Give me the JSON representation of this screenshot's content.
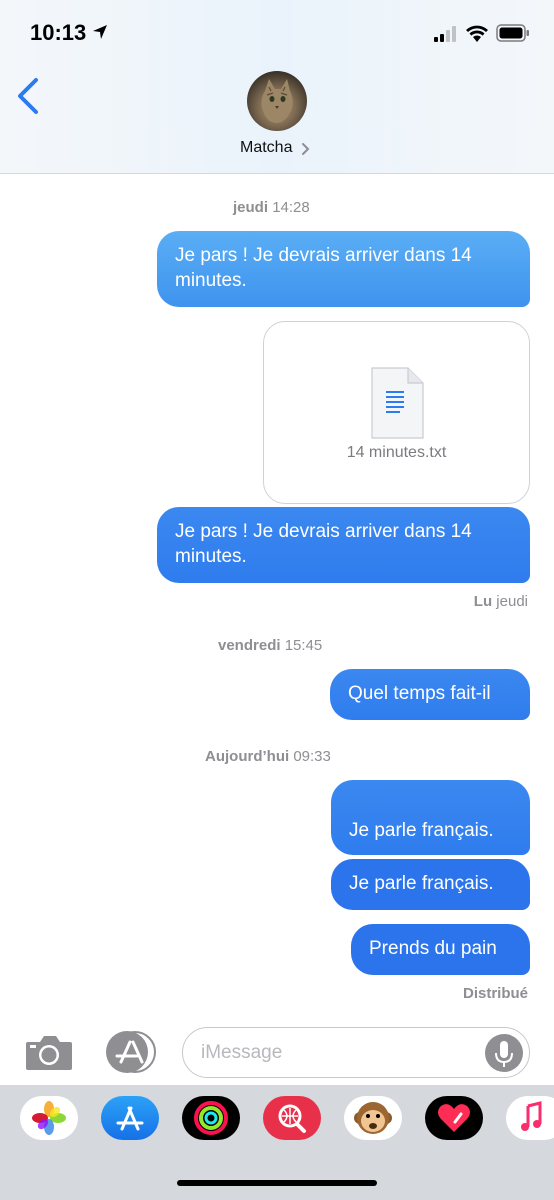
{
  "status_bar": {
    "time": "10:13"
  },
  "header": {
    "contact_name": "Matcha"
  },
  "timestamps": [
    {
      "day": "jeudi",
      "time": "14:28"
    },
    {
      "day": "vendredi",
      "time": "15:45"
    },
    {
      "day": "Aujourd’hui",
      "time": "09:33"
    }
  ],
  "messages": [
    {
      "text": "Je pars ! Je devrais arriver dans 14 minutes."
    },
    {
      "text": "Je pars ! Je devrais arriver dans 14 minutes."
    },
    {
      "text": "Quel temps fait-il"
    },
    {
      "text": "Je parle français."
    },
    {
      "text": "Je parle français."
    },
    {
      "text": "Prends du pain"
    }
  ],
  "attachment": {
    "file_name": "14 minutes.txt"
  },
  "receipts": {
    "read_label": "Lu",
    "read_day": "jeudi",
    "delivered": "Distribué"
  },
  "composer": {
    "placeholder": "iMessage"
  },
  "colors": {
    "bubble_blue": "#2b74ec",
    "accent": "#2b7cf0"
  },
  "app_drawer": [
    "photos-app",
    "app-store",
    "activity",
    "web-search",
    "animoji",
    "digital-touch",
    "music"
  ]
}
